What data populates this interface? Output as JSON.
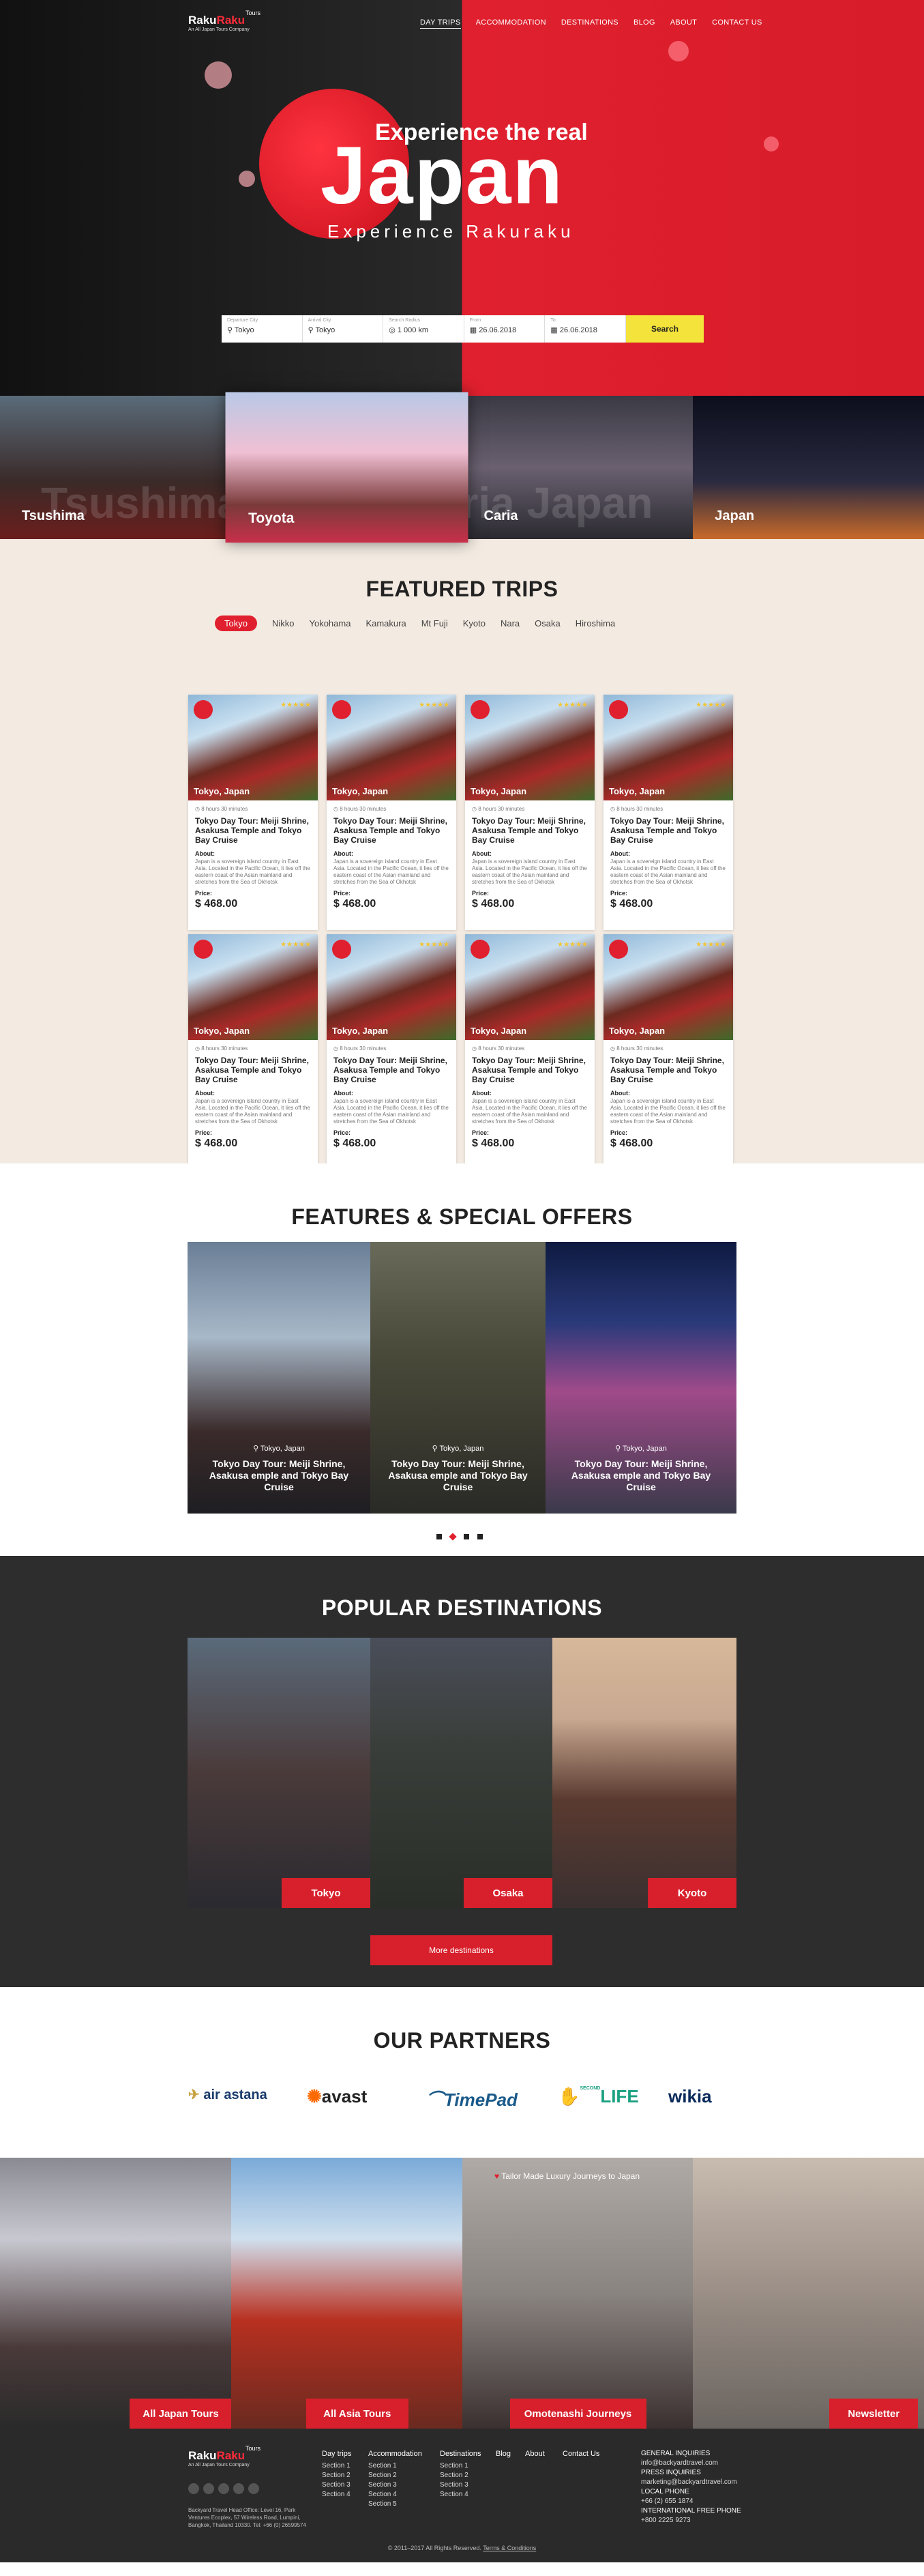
{
  "header": {
    "logo_a": "Raku",
    "logo_b": "Raku",
    "logo_tours": "Tours",
    "logo_sub": "An All Japan Tours Company",
    "nav": [
      "DAY TRIPS",
      "ACCOMMODATION",
      "DESTINATIONS",
      "BLOG",
      "ABOUT",
      "CONTACT US"
    ]
  },
  "hero": {
    "line1": "Experience the real",
    "line2": "Japan",
    "line3": "Experience Rakuraku",
    "search": {
      "fields": [
        {
          "label": "Departure City",
          "value": "Tokyo"
        },
        {
          "label": "Arrival City",
          "value": "Tokyo"
        },
        {
          "label": "Search Radius",
          "value": "1 000 km"
        },
        {
          "label": "From",
          "value": "26.06.2018"
        },
        {
          "label": "To",
          "value": "26.06.2018"
        }
      ],
      "button": "Search"
    }
  },
  "strip": {
    "ghost_text": "Tsushima Toyota Caria Japan",
    "items": [
      "Tsushima",
      "Toyota",
      "Caria",
      "Japan"
    ]
  },
  "featured": {
    "title": "FEATURED TRIPS",
    "tabs": [
      "Tokyo",
      "Nikko",
      "Yokohama",
      "Kamakura",
      "Mt Fuji",
      "Kyoto",
      "Nara",
      "Osaka",
      "Hiroshima"
    ],
    "card": {
      "location": "Tokyo, Japan",
      "duration": "8 hours 30 minutes",
      "title": "Tokyo Day Tour: Meiji Shrine, Asakusa Temple and Tokyo Bay Cruise",
      "about_label": "About:",
      "about": "Japan is a sovereign island country in East Asia. Located in the Pacific Ocean, it lies off the eastern coast of the Asian mainland and stretches from the Sea of Okhotsk",
      "price_label": "Price:",
      "price": "$ 468.00",
      "stars": "★★★★★"
    }
  },
  "offers": {
    "title": "FEATURES & SPECIAL OFFERS",
    "items": [
      {
        "location": "Tokyo, Japan",
        "title": "Tokyo Day Tour: Meiji Shrine, Asakusa emple and Tokyo Bay Cruise"
      },
      {
        "location": "Tokyo, Japan",
        "title": "Tokyo Day Tour: Meiji Shrine, Asakusa emple and Tokyo Bay Cruise"
      },
      {
        "location": "Tokyo, Japan",
        "title": "Tokyo Day Tour: Meiji Shrine, Asakusa emple and Tokyo Bay Cruise"
      }
    ]
  },
  "popular": {
    "title": "POPULAR DESTINATIONS",
    "items": [
      "Tokyo",
      "Osaka",
      "Kyoto"
    ],
    "more": "More destinations"
  },
  "partners": {
    "title": "OUR PARTNERS",
    "logos": [
      "air astana",
      "avast",
      "TimePad",
      "LIFE",
      "wikia"
    ],
    "life_small": "SECOND"
  },
  "bottom": {
    "tagline": "Tailor Made Luxury Journeys to Japan",
    "items": [
      "All Japan Tours",
      "All Asia Tours",
      "Omotenashi Journeys",
      "Newsletter"
    ]
  },
  "footer": {
    "address": "Backyard Travel Head Office: Level 16, Park Ventures Ecoplex, 57 Wireless Road, Lumpini, Bangkok, Thailand 10330. Tel: +66 (0) 26599574",
    "cols": [
      {
        "head": "Day trips",
        "items": [
          "Section 1",
          "Section 2",
          "Section 3",
          "Section 4"
        ]
      },
      {
        "head": "Accommodation",
        "items": [
          "Section 1",
          "Section 2",
          "Section 3",
          "Section 4",
          "Section 5"
        ]
      },
      {
        "head": "Destinations",
        "items": [
          "Section 1",
          "Section 2",
          "Section 3",
          "Section 4"
        ]
      },
      {
        "head": "Blog",
        "items": []
      },
      {
        "head": "About",
        "items": []
      },
      {
        "head": "Contact Us",
        "items": []
      }
    ],
    "contact": [
      "GENERAL INQUIRIES",
      "info@backyardtravel.com",
      "PRESS INQUIRIES",
      "marketing@backyardtravel.com",
      "LOCAL PHONE",
      "+66 (2) 655 1874",
      "INTERNATIONAL FREE PHONE",
      "+800 2225 9273"
    ],
    "copyright": "© 2011–2017 All Rights Reserved.",
    "terms": "Terms & Conditions"
  },
  "colors": {
    "accent": "#e0202e",
    "dark": "#2d2d2d",
    "search": "#f3e33a"
  }
}
